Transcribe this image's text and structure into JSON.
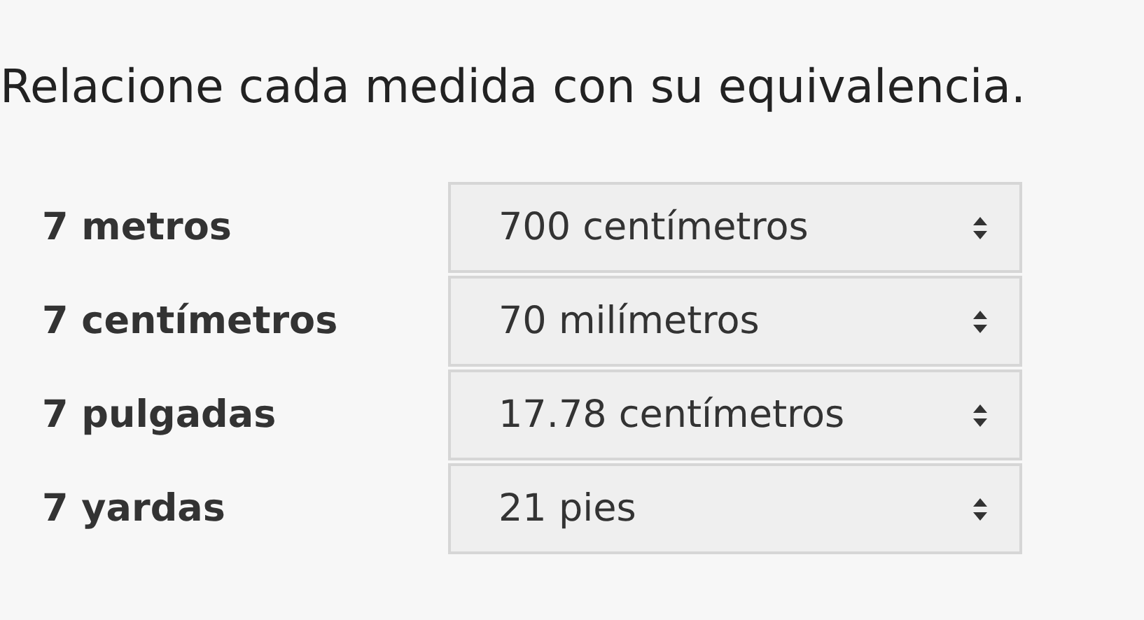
{
  "instruction": "Relacione cada medida con su equivalencia.",
  "rows": [
    {
      "measure": "7 metros",
      "answer": "700 centímetros"
    },
    {
      "measure": "7 centímetros",
      "answer": "70 milímetros"
    },
    {
      "measure": "7 pulgadas",
      "answer": "17.78 centímetros"
    },
    {
      "measure": "7 yardas",
      "answer": "21 pies"
    }
  ]
}
